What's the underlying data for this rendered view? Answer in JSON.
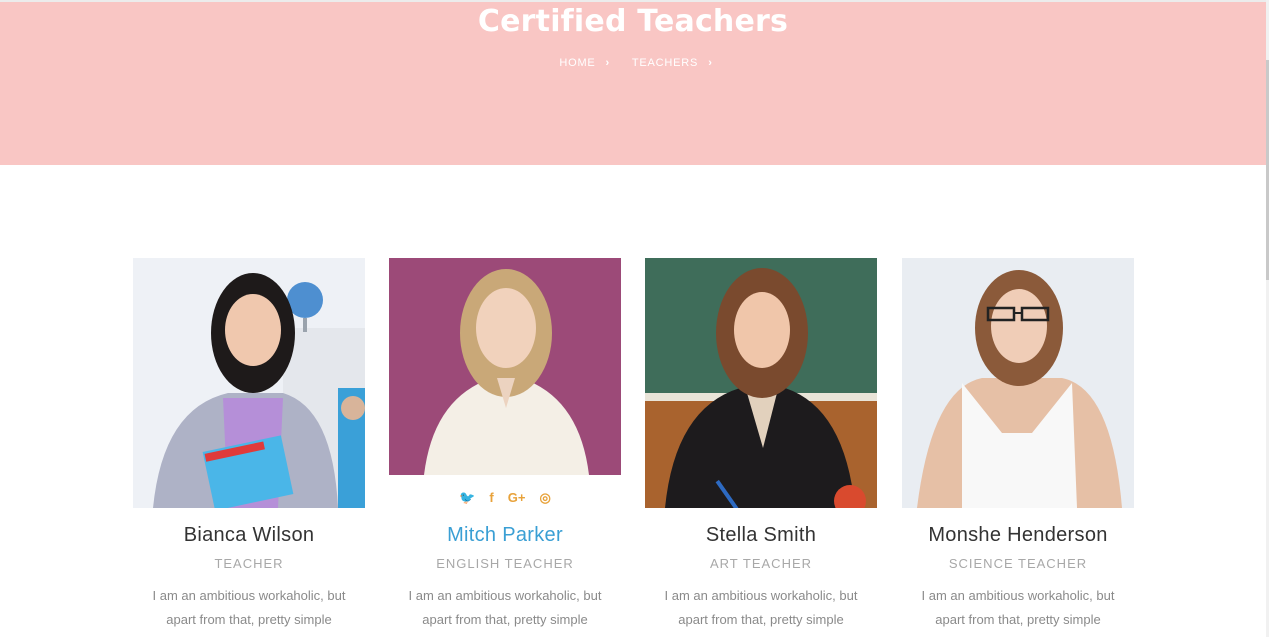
{
  "hero": {
    "title": "Certified Teachers",
    "breadcrumb": [
      {
        "label": "HOME"
      },
      {
        "label": "TEACHERS"
      }
    ]
  },
  "teachers": [
    {
      "name": "Bianca Wilson",
      "role": "TEACHER",
      "bio": "I am an ambitious workaholic, but apart from that, pretty simple"
    },
    {
      "name": "Mitch Parker",
      "role": "ENGLISH TEACHER",
      "bio": "I am an ambitious workaholic, but apart from that, pretty simple",
      "social": [
        "twitter-icon",
        "facebook-icon",
        "google-plus-icon",
        "instagram-icon"
      ]
    },
    {
      "name": "Stella Smith",
      "role": "ART TEACHER",
      "bio": "I am an ambitious workaholic, but apart from that, pretty simple"
    },
    {
      "name": "Monshe Henderson",
      "role": "SCIENCE TEACHER",
      "bio": "I am an ambitious workaholic, but apart from that, pretty simple"
    }
  ],
  "colors": {
    "hero_bg": "#f9c6c4",
    "accent": "#e8a23a",
    "active_name": "#3a9fd4"
  }
}
